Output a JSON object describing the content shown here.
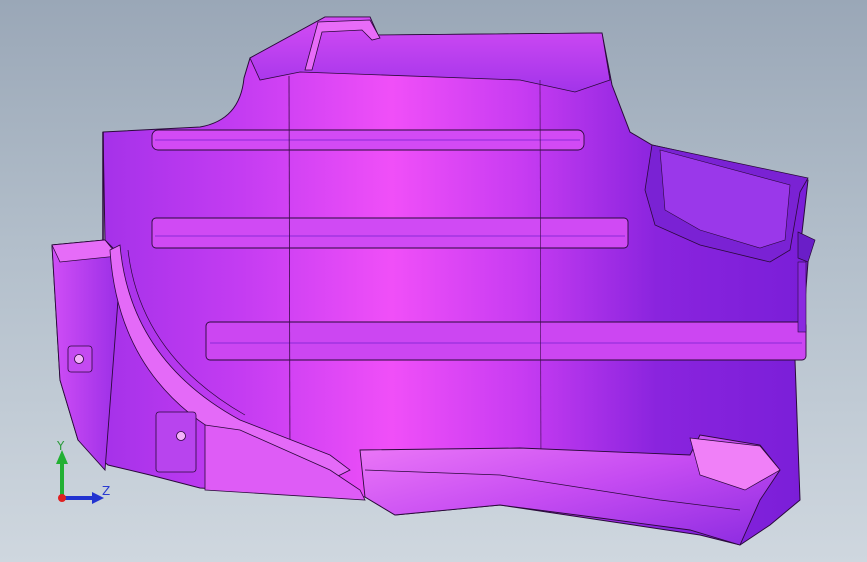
{
  "viewport": {
    "background_top": "#9aa7b7",
    "background_bottom": "#cfd7df"
  },
  "model": {
    "body_color": "#b03cf0",
    "highlight_color": "#ee4cf6",
    "shadow_color": "#7a22c4",
    "edge_color": "#2a0a3a"
  },
  "triad": {
    "y_label": "Y",
    "z_label": "Z",
    "y_color": "#22b033",
    "z_color": "#2233d0",
    "x_color": "#e02020"
  }
}
